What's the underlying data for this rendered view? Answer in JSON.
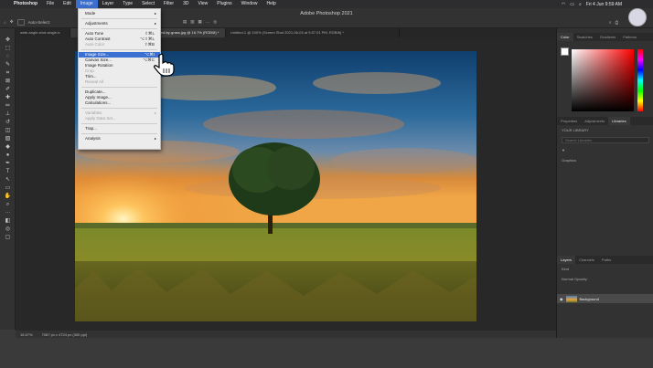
{
  "menubar": {
    "items": [
      "Photoshop",
      "File",
      "Edit",
      "Image",
      "Layer",
      "Type",
      "Select",
      "Filter",
      "3D",
      "View",
      "Plugins",
      "Window",
      "Help"
    ],
    "active_index": 3,
    "datetime": "Fri 4 Jun  9:59 AM"
  },
  "window": {
    "title": "Adobe Photoshop 2021"
  },
  "options": {
    "auto_select_label": "Auto-Select:"
  },
  "tabs": [
    "wide-angle-shot-single-tr",
    "scended-by-grass.jpg @ 16.7% (RGB/8) *",
    "Untitled-1 @ 100% (Screen Shot 2021-06-04 at 9.57.01 PM, RGB/8) *"
  ],
  "image_menu": {
    "items": [
      {
        "label": "Mode",
        "submenu": true
      },
      {
        "label": "Adjustments",
        "submenu": true
      },
      {
        "label": "Auto Tone",
        "shortcut": "⇧⌘L"
      },
      {
        "label": "Auto Contrast",
        "shortcut": "⌥⇧⌘L"
      },
      {
        "label": "Auto Color",
        "shortcut": "⇧⌘B",
        "disabled": true
      },
      {
        "label": "Image Size...",
        "shortcut": "⌥⌘I",
        "highlighted": true
      },
      {
        "label": "Canvas Size...",
        "shortcut": "⌥⌘C"
      },
      {
        "label": "Image Rotation",
        "submenu": true
      },
      {
        "label": "Crop",
        "disabled": true
      },
      {
        "label": "Trim..."
      },
      {
        "label": "Reveal All",
        "disabled": true
      },
      {
        "label": "Duplicate..."
      },
      {
        "label": "Apply Image..."
      },
      {
        "label": "Calculations..."
      },
      {
        "label": "Variables",
        "submenu": true,
        "disabled": true
      },
      {
        "label": "Apply Data Set...",
        "disabled": true
      },
      {
        "label": "Trap..."
      },
      {
        "label": "Analysis",
        "submenu": true
      }
    ]
  },
  "status": {
    "zoom": "16.67%",
    "doc_info": "7087 px x 4724 px (300 ppi)"
  },
  "panels": {
    "color_tabs": [
      "Color",
      "Swatches",
      "Gradients",
      "Patterns"
    ],
    "lib_tabs": [
      "Properties",
      "Adjustments",
      "Libraries"
    ],
    "library_label": "YOUR LIBRARY",
    "search_placeholder": "Search Libraries",
    "graphics_label": "Graphics",
    "layers_tabs": [
      "Layers",
      "Channels",
      "Paths"
    ],
    "layer_kind": "Kind",
    "layer_mode": "Normal",
    "layer_opacity": "Opacity:",
    "layer_name": "Background"
  },
  "colors": {
    "accent": "#3b6fd1",
    "menu_bg": "#ececec",
    "ui_dark": "#323232"
  }
}
